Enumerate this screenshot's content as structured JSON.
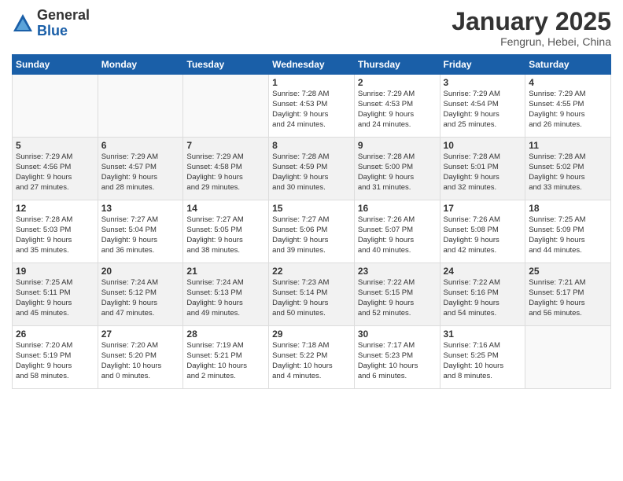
{
  "logo": {
    "general": "General",
    "blue": "Blue"
  },
  "title": "January 2025",
  "subtitle": "Fengrun, Hebei, China",
  "weekdays": [
    "Sunday",
    "Monday",
    "Tuesday",
    "Wednesday",
    "Thursday",
    "Friday",
    "Saturday"
  ],
  "weeks": [
    [
      {
        "day": "",
        "info": ""
      },
      {
        "day": "",
        "info": ""
      },
      {
        "day": "",
        "info": ""
      },
      {
        "day": "1",
        "info": "Sunrise: 7:28 AM\nSunset: 4:53 PM\nDaylight: 9 hours\nand 24 minutes."
      },
      {
        "day": "2",
        "info": "Sunrise: 7:29 AM\nSunset: 4:53 PM\nDaylight: 9 hours\nand 24 minutes."
      },
      {
        "day": "3",
        "info": "Sunrise: 7:29 AM\nSunset: 4:54 PM\nDaylight: 9 hours\nand 25 minutes."
      },
      {
        "day": "4",
        "info": "Sunrise: 7:29 AM\nSunset: 4:55 PM\nDaylight: 9 hours\nand 26 minutes."
      }
    ],
    [
      {
        "day": "5",
        "info": "Sunrise: 7:29 AM\nSunset: 4:56 PM\nDaylight: 9 hours\nand 27 minutes."
      },
      {
        "day": "6",
        "info": "Sunrise: 7:29 AM\nSunset: 4:57 PM\nDaylight: 9 hours\nand 28 minutes."
      },
      {
        "day": "7",
        "info": "Sunrise: 7:29 AM\nSunset: 4:58 PM\nDaylight: 9 hours\nand 29 minutes."
      },
      {
        "day": "8",
        "info": "Sunrise: 7:28 AM\nSunset: 4:59 PM\nDaylight: 9 hours\nand 30 minutes."
      },
      {
        "day": "9",
        "info": "Sunrise: 7:28 AM\nSunset: 5:00 PM\nDaylight: 9 hours\nand 31 minutes."
      },
      {
        "day": "10",
        "info": "Sunrise: 7:28 AM\nSunset: 5:01 PM\nDaylight: 9 hours\nand 32 minutes."
      },
      {
        "day": "11",
        "info": "Sunrise: 7:28 AM\nSunset: 5:02 PM\nDaylight: 9 hours\nand 33 minutes."
      }
    ],
    [
      {
        "day": "12",
        "info": "Sunrise: 7:28 AM\nSunset: 5:03 PM\nDaylight: 9 hours\nand 35 minutes."
      },
      {
        "day": "13",
        "info": "Sunrise: 7:27 AM\nSunset: 5:04 PM\nDaylight: 9 hours\nand 36 minutes."
      },
      {
        "day": "14",
        "info": "Sunrise: 7:27 AM\nSunset: 5:05 PM\nDaylight: 9 hours\nand 38 minutes."
      },
      {
        "day": "15",
        "info": "Sunrise: 7:27 AM\nSunset: 5:06 PM\nDaylight: 9 hours\nand 39 minutes."
      },
      {
        "day": "16",
        "info": "Sunrise: 7:26 AM\nSunset: 5:07 PM\nDaylight: 9 hours\nand 40 minutes."
      },
      {
        "day": "17",
        "info": "Sunrise: 7:26 AM\nSunset: 5:08 PM\nDaylight: 9 hours\nand 42 minutes."
      },
      {
        "day": "18",
        "info": "Sunrise: 7:25 AM\nSunset: 5:09 PM\nDaylight: 9 hours\nand 44 minutes."
      }
    ],
    [
      {
        "day": "19",
        "info": "Sunrise: 7:25 AM\nSunset: 5:11 PM\nDaylight: 9 hours\nand 45 minutes."
      },
      {
        "day": "20",
        "info": "Sunrise: 7:24 AM\nSunset: 5:12 PM\nDaylight: 9 hours\nand 47 minutes."
      },
      {
        "day": "21",
        "info": "Sunrise: 7:24 AM\nSunset: 5:13 PM\nDaylight: 9 hours\nand 49 minutes."
      },
      {
        "day": "22",
        "info": "Sunrise: 7:23 AM\nSunset: 5:14 PM\nDaylight: 9 hours\nand 50 minutes."
      },
      {
        "day": "23",
        "info": "Sunrise: 7:22 AM\nSunset: 5:15 PM\nDaylight: 9 hours\nand 52 minutes."
      },
      {
        "day": "24",
        "info": "Sunrise: 7:22 AM\nSunset: 5:16 PM\nDaylight: 9 hours\nand 54 minutes."
      },
      {
        "day": "25",
        "info": "Sunrise: 7:21 AM\nSunset: 5:17 PM\nDaylight: 9 hours\nand 56 minutes."
      }
    ],
    [
      {
        "day": "26",
        "info": "Sunrise: 7:20 AM\nSunset: 5:19 PM\nDaylight: 9 hours\nand 58 minutes."
      },
      {
        "day": "27",
        "info": "Sunrise: 7:20 AM\nSunset: 5:20 PM\nDaylight: 10 hours\nand 0 minutes."
      },
      {
        "day": "28",
        "info": "Sunrise: 7:19 AM\nSunset: 5:21 PM\nDaylight: 10 hours\nand 2 minutes."
      },
      {
        "day": "29",
        "info": "Sunrise: 7:18 AM\nSunset: 5:22 PM\nDaylight: 10 hours\nand 4 minutes."
      },
      {
        "day": "30",
        "info": "Sunrise: 7:17 AM\nSunset: 5:23 PM\nDaylight: 10 hours\nand 6 minutes."
      },
      {
        "day": "31",
        "info": "Sunrise: 7:16 AM\nSunset: 5:25 PM\nDaylight: 10 hours\nand 8 minutes."
      },
      {
        "day": "",
        "info": ""
      }
    ]
  ]
}
